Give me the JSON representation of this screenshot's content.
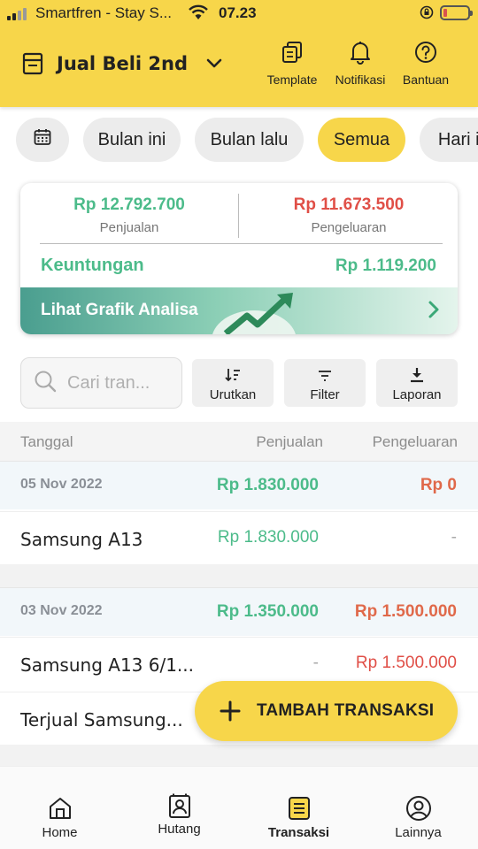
{
  "status_bar": {
    "carrier": "Smartfren - Stay S...",
    "time": "07.23"
  },
  "header": {
    "store_name": "Jual Beli 2nd",
    "actions": [
      {
        "label": "Template",
        "icon": "template-icon"
      },
      {
        "label": "Notifikasi",
        "icon": "bell-icon"
      },
      {
        "label": "Bantuan",
        "icon": "help-icon"
      }
    ]
  },
  "filters": {
    "calendar_icon": "calendar-icon",
    "chips": [
      {
        "label": "Bulan ini",
        "active": false
      },
      {
        "label": "Bulan lalu",
        "active": false
      },
      {
        "label": "Semua",
        "active": true
      },
      {
        "label": "Hari ini",
        "active": false
      }
    ]
  },
  "summary": {
    "sales_value": "Rp 12.792.700",
    "sales_label": "Penjualan",
    "expense_value": "Rp 11.673.500",
    "expense_label": "Pengeluaran",
    "profit_label": "Keuntungan",
    "profit_value": "Rp 1.119.200",
    "analytics_label": "Lihat Grafik Analisa"
  },
  "search": {
    "placeholder": "Cari tran..."
  },
  "tools": {
    "sort_label": "Urutkan",
    "filter_label": "Filter",
    "report_label": "Laporan"
  },
  "table": {
    "columns": [
      "Tanggal",
      "Penjualan",
      "Pengeluaran"
    ],
    "groups": [
      {
        "date": "05 Nov 2022",
        "sales_total": "Rp 1.830.000",
        "expense_total": "Rp 0",
        "items": [
          {
            "name": "Samsung A13",
            "sales": "Rp 1.830.000",
            "expense": "-"
          }
        ]
      },
      {
        "date": "03 Nov 2022",
        "sales_total": "Rp 1.350.000",
        "expense_total": "Rp 1.500.000",
        "items": [
          {
            "name": "Samsung A13 6/1...",
            "sales": "-",
            "expense": "Rp 1.500.000"
          },
          {
            "name": "Terjual Samsung...",
            "sales": "",
            "expense": ""
          }
        ]
      }
    ]
  },
  "fab": {
    "label": "TAMBAH TRANSAKSI"
  },
  "bottom_nav": [
    {
      "label": "Home",
      "icon": "home-icon",
      "active": false
    },
    {
      "label": "Hutang",
      "icon": "debt-icon",
      "active": false
    },
    {
      "label": "Transaksi",
      "icon": "transaction-icon",
      "active": true
    },
    {
      "label": "Lainnya",
      "icon": "profile-icon",
      "active": false
    }
  ],
  "colors": {
    "accent": "#f7d64a",
    "income": "#4cbb8a",
    "expense": "#e04f47"
  }
}
